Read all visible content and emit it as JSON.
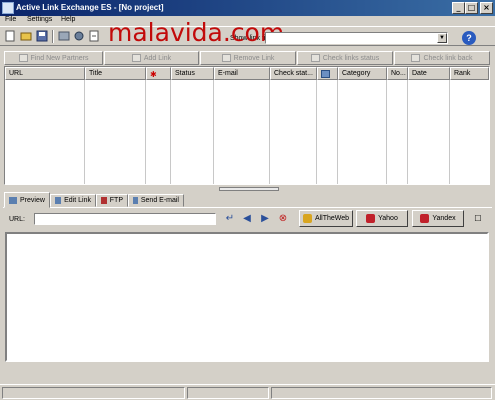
{
  "window": {
    "title": "Active Link Exchange ES - [No project]",
    "controls": [
      "_",
      "□",
      "×"
    ]
  },
  "watermark": "malavida.com",
  "menu": [
    {
      "label": "File"
    },
    {
      "label": "Settings"
    },
    {
      "label": "Help"
    }
  ],
  "toolbar": {
    "filter_label": "Show link filter:",
    "filter_value": "",
    "help_label": "?"
  },
  "actions": [
    {
      "label": "Find New Partners"
    },
    {
      "label": "Add Link"
    },
    {
      "label": "Remove Link"
    },
    {
      "label": "Check links status"
    },
    {
      "label": "Check link back"
    }
  ],
  "table": {
    "columns": [
      "URL",
      "Title",
      "",
      "Status",
      "E-mail",
      "Check stat...",
      "",
      "Category",
      "No...",
      "Date",
      "Rank"
    ],
    "rows": []
  },
  "tabs": [
    {
      "label": "Preview"
    },
    {
      "label": "Edit Link"
    },
    {
      "label": "FTP"
    },
    {
      "label": "Send E-mail"
    }
  ],
  "browser": {
    "url_label": "URL:",
    "url_value": "",
    "engines": [
      {
        "label": "AllTheWeb",
        "color": "#d8a520"
      },
      {
        "label": "Yahoo",
        "color": "#c0202a"
      },
      {
        "label": "Yandex",
        "color": "#c0202a"
      }
    ],
    "nav_icons": [
      "enter-icon",
      "back-icon",
      "forward-icon",
      "stop-icon"
    ]
  },
  "colors": {
    "titlebar_start": "#0a246a",
    "titlebar_end": "#3a6ea5",
    "face": "#d4d0c8",
    "watermark": "#c20a0a"
  }
}
